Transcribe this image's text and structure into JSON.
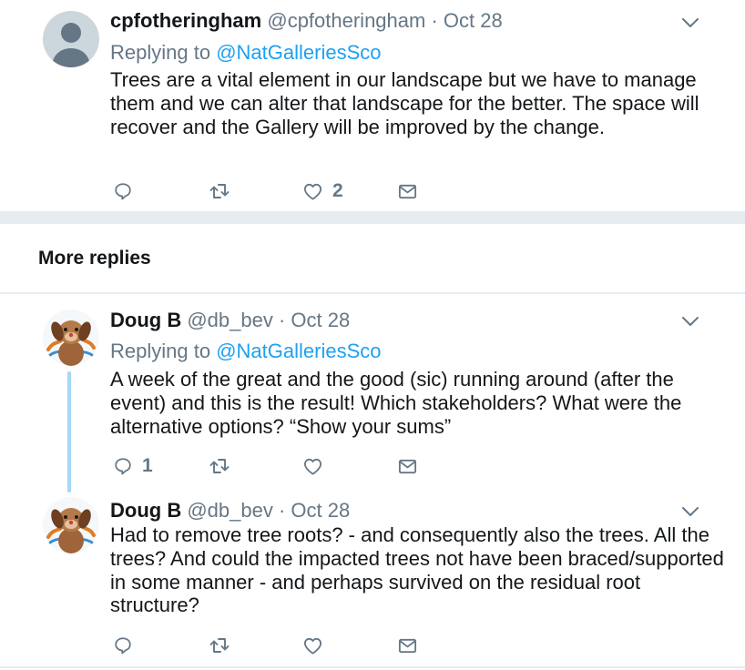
{
  "tweets": [
    {
      "name": "cpfotheringham",
      "handle": "@cpfotheringham",
      "date": "· Oct 28",
      "replying_label": "Replying to ",
      "replying_handle": "@NatGalleriesSco",
      "text": "Trees are a vital element in our landscape but we have to manage them and we can alter that landscape for the better. The space will recover and the Gallery will be improved by the change.",
      "reply_count": "",
      "like_count": "2",
      "avatar": "default-avatar"
    },
    {
      "name": "Doug B",
      "handle": "@db_bev",
      "date": "· Oct 28",
      "replying_label": "Replying to ",
      "replying_handle": "@NatGalleriesSco",
      "text": "A week of the great and the good (sic) running around (after the event) and this is the result! Which stakeholders? What were the alternative options? “Show your sums”",
      "reply_count": "1",
      "like_count": "",
      "avatar": "toy-dog-photo"
    },
    {
      "name": "Doug B",
      "handle": "@db_bev",
      "date": "· Oct 28",
      "text": "Had to remove tree roots? - and consequently also the trees. All the trees? And could the impacted trees not have been braced/supported in some manner - and perhaps survived on the residual root structure?",
      "reply_count": "",
      "like_count": "",
      "avatar": "toy-dog-photo"
    }
  ],
  "section": {
    "more_replies": "More replies"
  },
  "icons": [
    "reply-icon",
    "retweet-icon",
    "like-icon",
    "direct-message-icon",
    "chevron-down-icon"
  ],
  "colors": {
    "text": "#14171a",
    "secondary": "#657786",
    "link": "#1da1f2",
    "divider": "#e6ecf0",
    "thread": "#a6d8f7"
  }
}
